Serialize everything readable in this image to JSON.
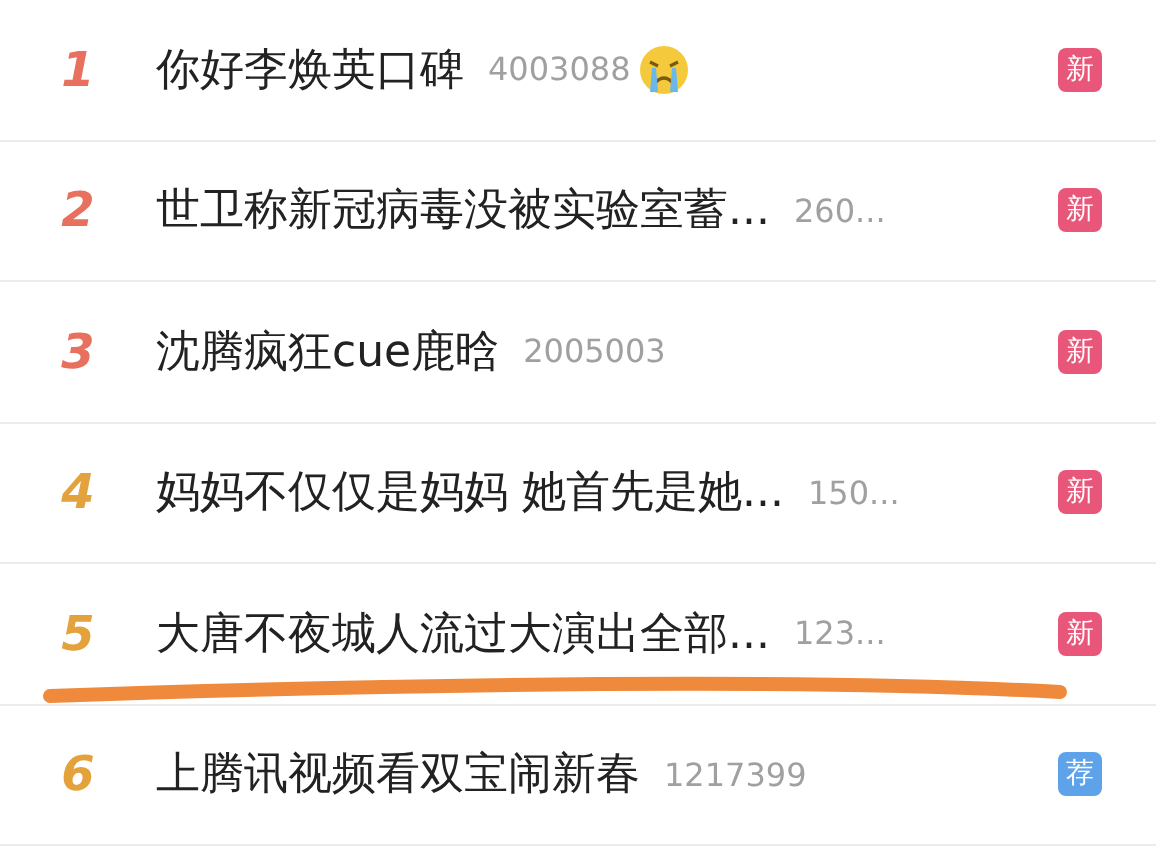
{
  "hot_list": [
    {
      "rank": "1",
      "color": "#e8705f",
      "title": "你好李焕英口碑",
      "count": "4003088",
      "emoji": true,
      "underlined": false,
      "badge": {
        "kind": "new",
        "text": "新"
      }
    },
    {
      "rank": "2",
      "color": "#e8705f",
      "title": "世卫称新冠病毒没被实验室蓄...",
      "count": "260...",
      "emoji": false,
      "underlined": false,
      "badge": {
        "kind": "new",
        "text": "新"
      }
    },
    {
      "rank": "3",
      "color": "#e8705f",
      "title": "沈腾疯狂cue鹿晗",
      "count": "2005003",
      "emoji": false,
      "underlined": false,
      "badge": {
        "kind": "new",
        "text": "新"
      }
    },
    {
      "rank": "4",
      "color": "#e4a23c",
      "title": "妈妈不仅仅是妈妈 她首先是她...",
      "count": "150...",
      "emoji": false,
      "underlined": false,
      "badge": {
        "kind": "new",
        "text": "新"
      }
    },
    {
      "rank": "5",
      "color": "#e4a23c",
      "title": "大唐不夜城人流过大演出全部...",
      "count": "123...",
      "emoji": false,
      "underlined": true,
      "badge": {
        "kind": "new",
        "text": "新"
      }
    },
    {
      "rank": "6",
      "color": "#e4a23c",
      "title": "上腾讯视频看双宝闹新春",
      "count": "1217399",
      "emoji": false,
      "underlined": false,
      "badge": {
        "kind": "recommend",
        "text": "荐"
      }
    }
  ]
}
